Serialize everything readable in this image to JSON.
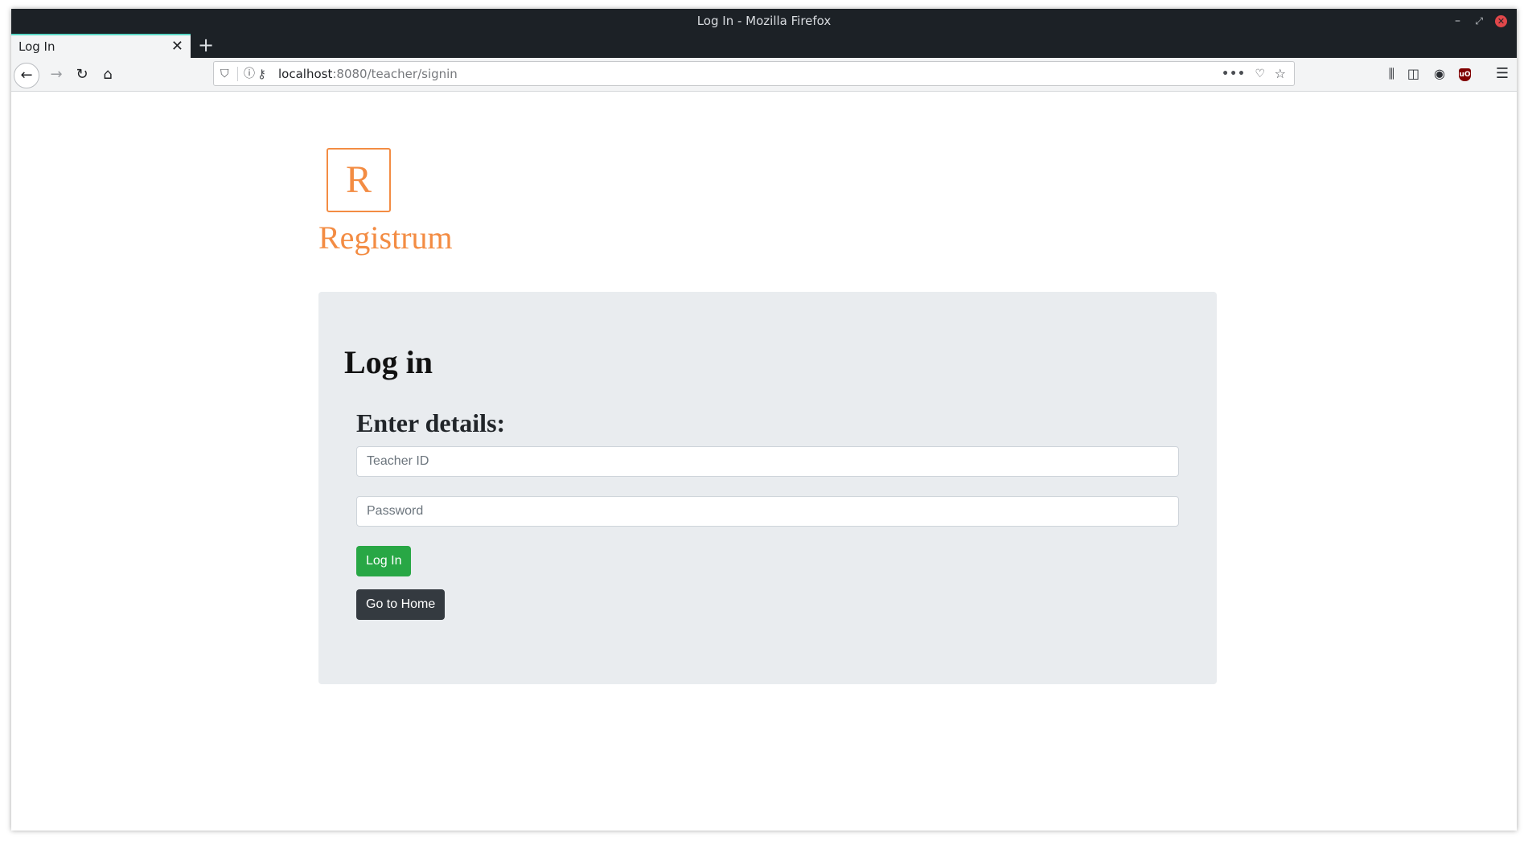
{
  "window": {
    "title": "Log In - Mozilla Firefox",
    "controls": {
      "minimize": "–",
      "maximize": "⤢",
      "close": "✕"
    }
  },
  "tab": {
    "title": "Log In",
    "close": "✕",
    "new_tab": "+"
  },
  "nav": {
    "back": "←",
    "forward": "→",
    "reload": "↻",
    "home": "⌂",
    "url_host": "localhost",
    "url_rest": ":8080/teacher/signin",
    "icons": {
      "shield": "⛉",
      "info": "ⓘ",
      "key": "⚷",
      "more": "•••",
      "pocket": "♡",
      "star": "☆",
      "library": "⫼",
      "sidebar": "◫",
      "account": "◉",
      "ublock": "uO",
      "menu": "☰"
    }
  },
  "brand": {
    "logo_letter": "R",
    "name": "Registrum",
    "color": "#f38c43"
  },
  "login": {
    "heading": "Log in",
    "subheading": "Enter details:",
    "teacher_id_placeholder": "Teacher ID",
    "password_placeholder": "Password",
    "login_button": "Log In",
    "home_button": "Go to Home",
    "login_color": "#28a745",
    "home_color": "#343a40"
  }
}
